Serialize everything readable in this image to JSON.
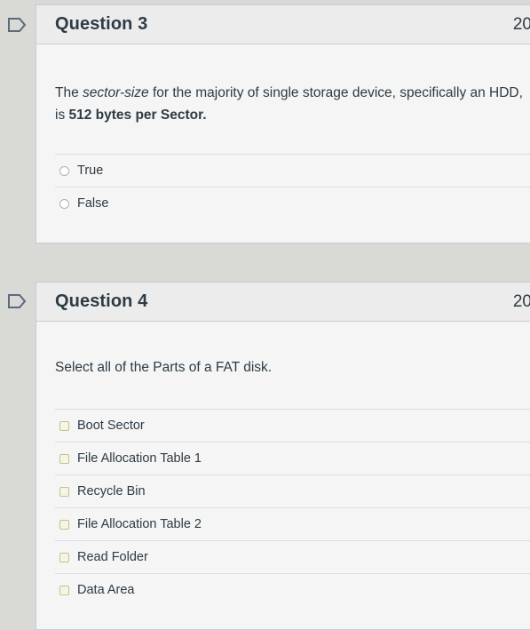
{
  "questions": [
    {
      "title": "Question 3",
      "points": "20",
      "text_prefix": "The ",
      "text_italic": "sector-size",
      "text_middle": " for the majority of single storage device, specifically an HDD, is ",
      "text_bold": "512 bytes per Sector.",
      "answer_type": "radio",
      "answers": [
        "True",
        "False"
      ]
    },
    {
      "title": "Question 4",
      "points": "20",
      "text": "Select all of the Parts of a FAT disk.",
      "answer_type": "checkbox",
      "answers": [
        "Boot Sector",
        "File Allocation Table 1",
        "Recycle Bin",
        "File Allocation Table 2",
        "Read Folder",
        "Data Area"
      ]
    }
  ],
  "icons": {
    "flag": "flag-question-icon"
  },
  "colors": {
    "page_bg": "#d9d9d6",
    "card_bg": "#f5f5f5",
    "header_bg": "#ececec",
    "text": "#2d3b45"
  }
}
